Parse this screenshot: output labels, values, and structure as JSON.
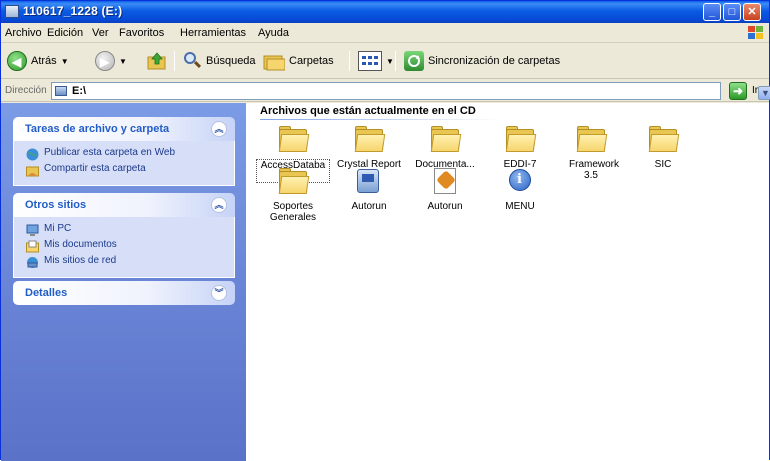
{
  "window": {
    "title": "110617_1228 (E:)",
    "accent_color": "#0A5BE3"
  },
  "menubar": {
    "items": [
      "Archivo",
      "Edición",
      "Ver",
      "Favoritos",
      "Herramientas",
      "Ayuda"
    ]
  },
  "toolbar": {
    "back_label": "Atrás",
    "search_label": "Búsqueda",
    "folders_label": "Carpetas",
    "sync_label": "Sincronización de carpetas"
  },
  "address": {
    "label": "Dirección",
    "value": "E:\\",
    "go_label": "Ir"
  },
  "taskpane": {
    "panels": [
      {
        "title": "Tareas de archivo y carpeta",
        "links": [
          {
            "label": "Publicar esta carpeta en Web",
            "icon": "globe-icon"
          },
          {
            "label": "Compartir esta carpeta",
            "icon": "share-folder-icon"
          }
        ]
      },
      {
        "title": "Otros sitios",
        "links": [
          {
            "label": "Mi PC",
            "icon": "computer-icon"
          },
          {
            "label": "Mis documentos",
            "icon": "documents-folder-icon"
          },
          {
            "label": "Mis sitios de red",
            "icon": "network-icon"
          }
        ]
      },
      {
        "title": "Detalles",
        "links": []
      }
    ]
  },
  "content": {
    "group_header": "Archivos que están actualmente en el CD",
    "items": [
      {
        "label": "AccessDataba se",
        "icon": "folder-icon"
      },
      {
        "label": "Crystal Report",
        "icon": "folder-icon"
      },
      {
        "label": "Documenta...",
        "icon": "folder-icon"
      },
      {
        "label": "EDDI-7",
        "icon": "folder-icon"
      },
      {
        "label": "Framework 3.5",
        "icon": "folder-icon"
      },
      {
        "label": "SIC",
        "icon": "folder-icon"
      },
      {
        "label": "Soportes Generales",
        "icon": "folder-icon"
      },
      {
        "label": "Autorun",
        "icon": "autorun-exe-icon"
      },
      {
        "label": "Autorun",
        "icon": "autorun-inf-icon"
      },
      {
        "label": "MENU",
        "icon": "info-icon"
      }
    ]
  }
}
